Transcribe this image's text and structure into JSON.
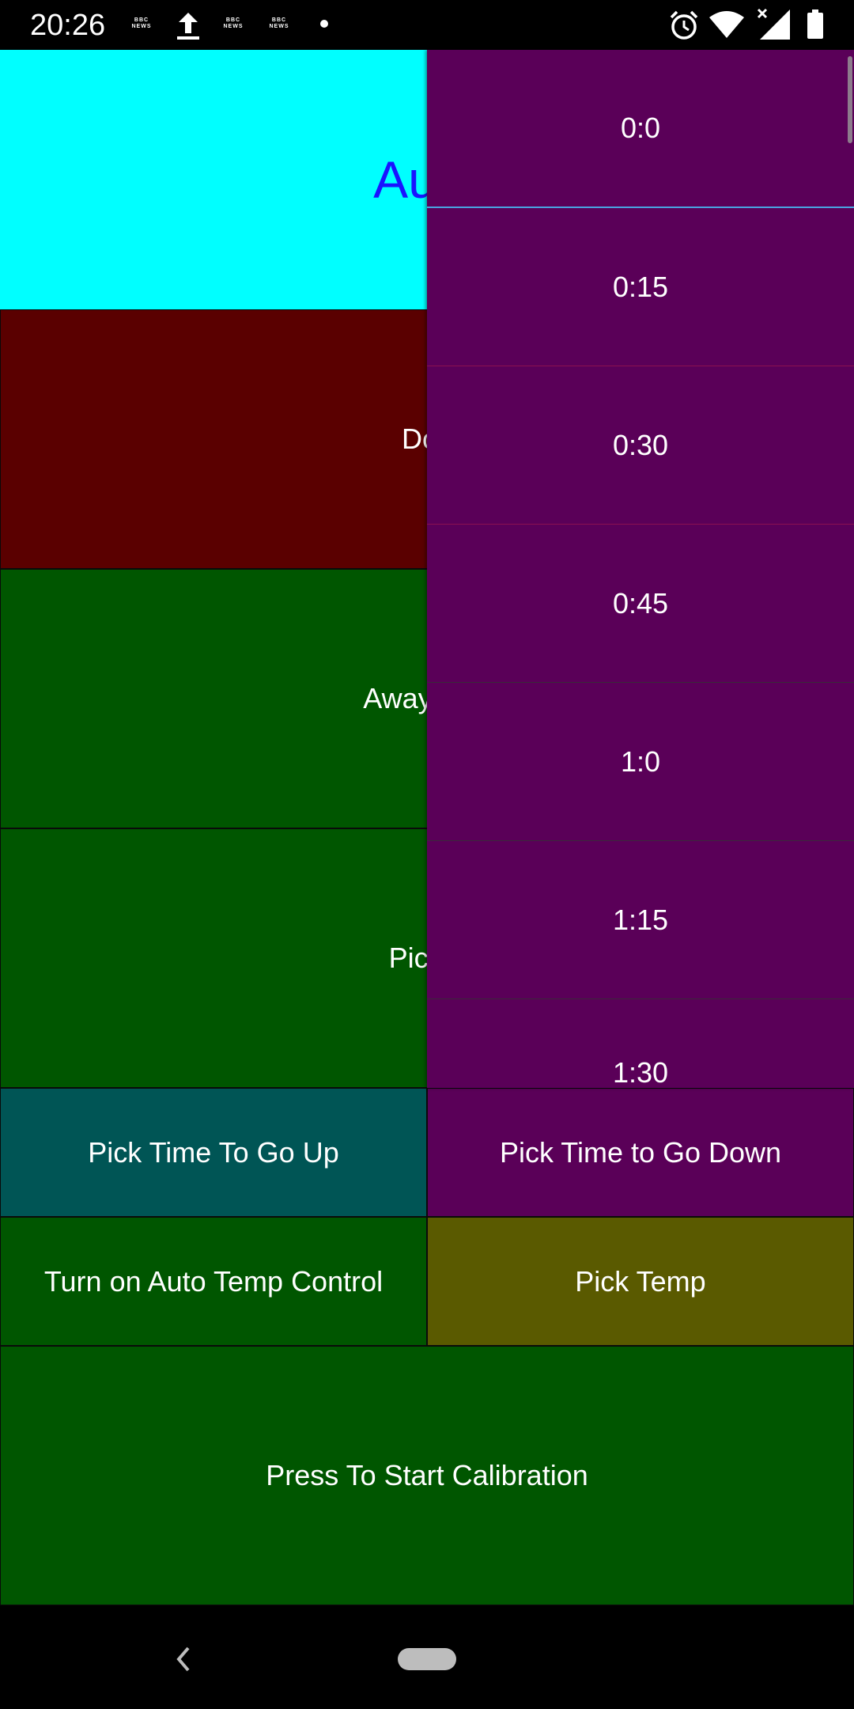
{
  "status_bar": {
    "time": "20:26",
    "notification_icons": [
      "bbc-news-icon",
      "upload-icon",
      "bbc-news-icon",
      "bbc-news-icon",
      "dot-icon"
    ],
    "news_label_top": "BBC",
    "news_label_bottom": "NEWS",
    "system_icons": [
      "alarm-icon",
      "wifi-icon",
      "signal-icon",
      "battery-icon"
    ]
  },
  "tiles": {
    "header": "Auto",
    "down": "Dov",
    "away": "AwayFron",
    "pick_time": "PickTi"
  },
  "buttons": {
    "pick_up": "Pick Time To Go Up",
    "pick_down": "Pick Time to Go Down",
    "auto_temp": "Turn on Auto Temp Control",
    "pick_temp": "Pick Temp",
    "calibration": "Press To Start Calibration"
  },
  "dropdown": {
    "items": [
      "0:0",
      "0:15",
      "0:30",
      "0:45",
      "1:0",
      "1:15",
      "1:30"
    ],
    "selected": "0:0"
  },
  "colors": {
    "header_bg": "#00ffff",
    "header_text": "#1a14ff",
    "down_bg": "#5a0000",
    "green_bg": "#005600",
    "teal_bg": "#005555",
    "purple_bg": "#5a0058",
    "olive_bg": "#5a5a00"
  }
}
